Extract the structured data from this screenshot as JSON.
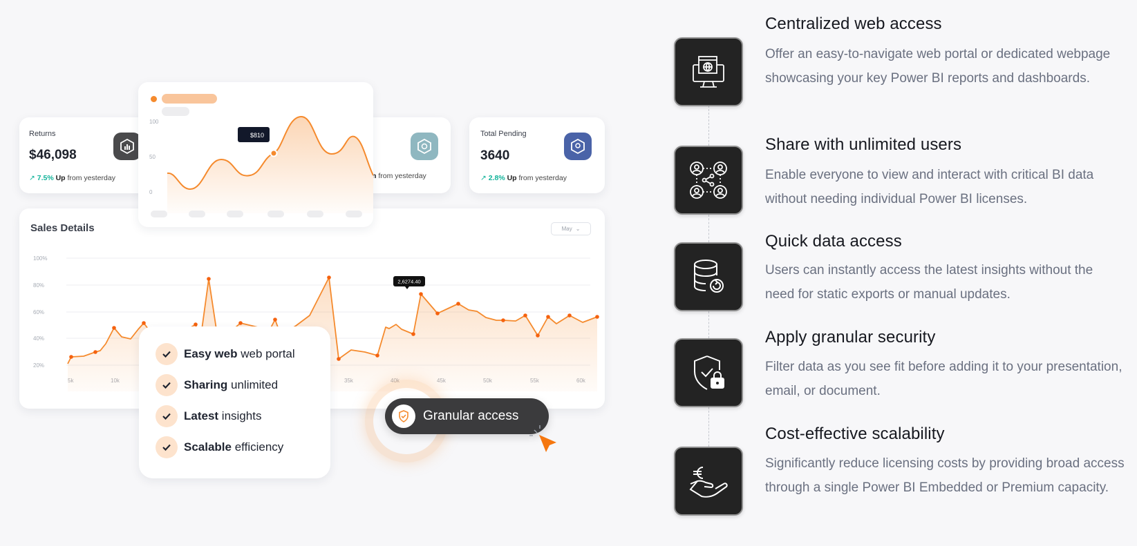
{
  "stats": [
    {
      "label": "Returns",
      "value": "$46,098",
      "pct": "7.5%",
      "up": "Up",
      "suffix": "from yesterday",
      "icon": "hexagon-chart-icon"
    },
    {
      "label": "",
      "value": "",
      "pct": "",
      "up": "Up",
      "suffix": "from yesterday",
      "icon": "box-icon"
    },
    {
      "label": "Total Pending",
      "value": "3640",
      "pct": "2.8%",
      "up": "Up",
      "suffix": "from yesterday",
      "icon": "hexagon-badge-icon"
    }
  ],
  "mini_chart": {
    "tooltip": "$810",
    "y_ticks": [
      "100",
      "50",
      "0"
    ]
  },
  "sales": {
    "title": "Sales Details",
    "month": "May",
    "tooltip": "2,6274.40",
    "y_ticks": [
      "100%",
      "80%",
      "60%",
      "40%",
      "20%"
    ],
    "x_ticks": [
      "5k",
      "10k",
      "35k",
      "40k",
      "45k",
      "50k",
      "55k",
      "60k"
    ]
  },
  "checklist": [
    {
      "bold": "Easy web",
      "rest": " web portal"
    },
    {
      "bold": "Sharing",
      "rest": " unlimited"
    },
    {
      "bold": "Latest",
      "rest": " insights"
    },
    {
      "bold": "Scalable",
      "rest": " efficiency"
    }
  ],
  "pill": {
    "label": "Granular access"
  },
  "features": [
    {
      "title": "Centralized web access",
      "desc": "Offer an easy-to-navigate web portal or dedicated webpage showcasing your key Power BI reports and dashboards.",
      "icon": "monitor-globe-icon"
    },
    {
      "title": "Share with unlimited users",
      "desc": "Enable everyone to view and interact with critical BI data without needing individual Power BI licenses.",
      "icon": "users-share-icon"
    },
    {
      "title": "Quick data access",
      "desc": "Users can instantly access the latest insights without the need for static exports or manual updates.",
      "icon": "database-refresh-icon"
    },
    {
      "title": "Apply granular security",
      "desc": "Filter data as you see fit before adding it to your presentation, email, or document.",
      "icon": "shield-lock-icon"
    },
    {
      "title": "Cost-effective scalability",
      "desc": "Significantly reduce licensing costs by providing broad access through a single Power BI Embedded or Premium capacity.",
      "icon": "hand-euro-icon"
    }
  ],
  "colors": {
    "accent": "#f58a2d",
    "icon_bg": "#232323",
    "teal": "#12b39a"
  }
}
